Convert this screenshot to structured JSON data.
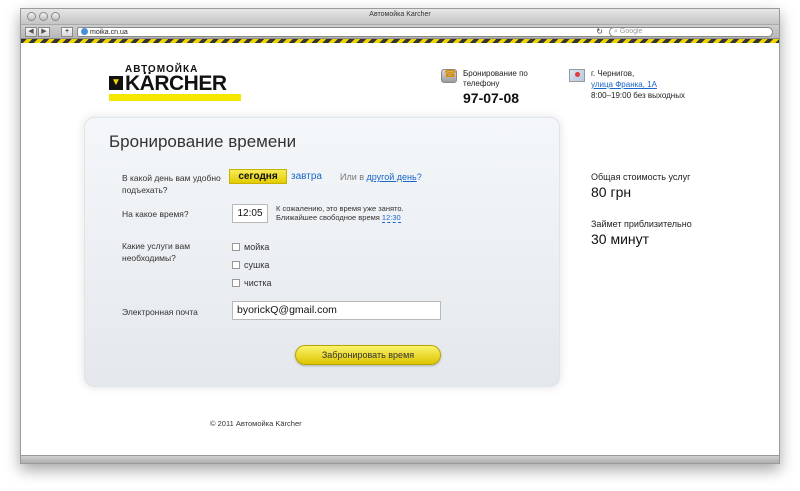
{
  "browser": {
    "window_title": "Автомойка Karcher",
    "url": "moika.cn.ua",
    "search_placeholder": "Google",
    "reload_icon": "reload-icon",
    "back_icon": "back-arrow-icon",
    "forward_icon": "forward-arrow-icon",
    "add_label": "+"
  },
  "header": {
    "logo_sub": "АВТОМОЙКА",
    "logo_main": "KÄRCHER",
    "phone_label": "Бронирование по телефону",
    "phone_number": "97-07-08",
    "address_city": "г. Чернигов,",
    "address_street": "улица Франка, 1А",
    "address_hours": "8:00–19:00 без выходных"
  },
  "form": {
    "title": "Бронирование времени",
    "day_question": "В какой день вам удобно подъехать?",
    "today_label": "сегодня",
    "tomorrow_label": "завтра",
    "other_day_prefix": "Или в ",
    "other_day_link": "другой день",
    "other_day_suffix": "?",
    "time_question": "На какое время?",
    "time_value": "12:05",
    "time_note_line1": "К сожалению, это время уже занято.",
    "time_note_line2": "Ближайшее свободное время ",
    "time_note_free": "12:30",
    "services_question": "Какие услуги вам необходимы?",
    "services": [
      {
        "label": "мойка",
        "checked": false
      },
      {
        "label": "сушка",
        "checked": false
      },
      {
        "label": "чистка",
        "checked": false
      }
    ],
    "email_label": "Электронная почта",
    "email_value": "byorickQ@gmail.com",
    "submit_label": "Забронировать время"
  },
  "summary": {
    "total_label": "Общая стоимость услуг",
    "total_value": "80 грн",
    "duration_label": "Займет приблизительно",
    "duration_value": "30 минут"
  },
  "footer": {
    "copyright": "© 2011 Автомойка Kärcher"
  },
  "colors": {
    "accent_yellow": "#f4e800",
    "link_blue": "#1a66c9"
  }
}
